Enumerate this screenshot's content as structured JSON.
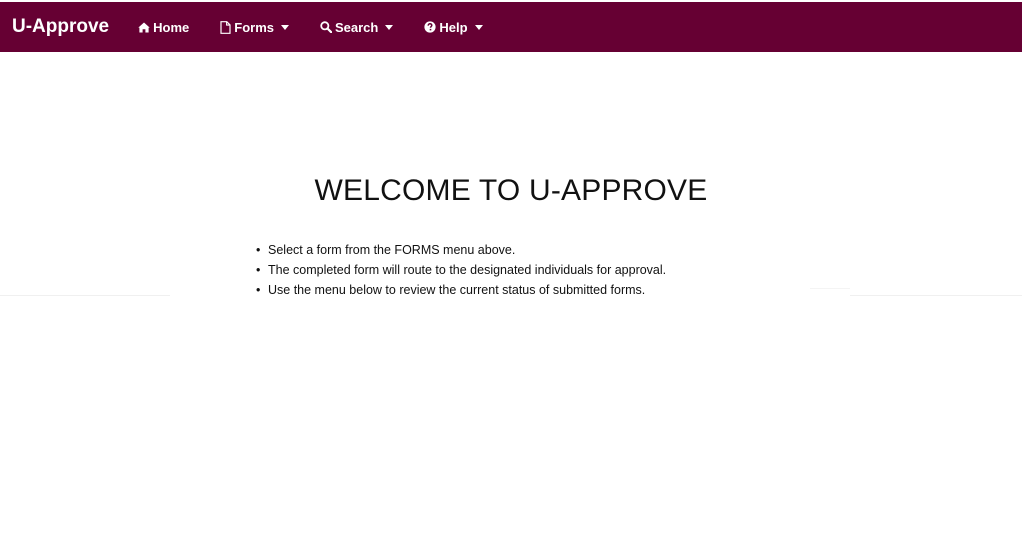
{
  "navbar": {
    "brand": "U-Approve",
    "items": [
      {
        "label": "Home",
        "icon": "home-icon",
        "dropdown": false
      },
      {
        "label": "Forms",
        "icon": "document-icon",
        "dropdown": true
      },
      {
        "label": "Search",
        "icon": "search-icon",
        "dropdown": true
      },
      {
        "label": "Help",
        "icon": "question-circle-icon",
        "dropdown": true
      }
    ],
    "background_color": "#660033"
  },
  "main": {
    "title": "WELCOME TO U-APPROVE",
    "instructions": [
      "Select a form from the FORMS menu above.",
      "The completed form will route to the designated individuals for approval.",
      "Use the menu below to review the current status of submitted forms."
    ]
  }
}
